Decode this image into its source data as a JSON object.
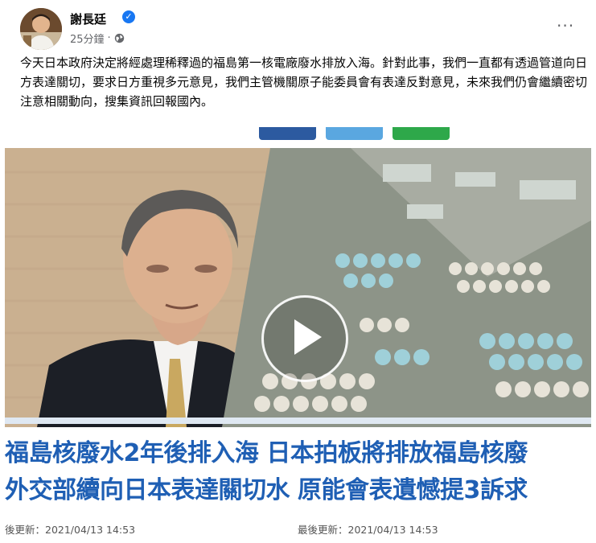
{
  "post": {
    "author": "謝長廷",
    "time": "25分鐘",
    "time_separator": "·",
    "more_label": "···",
    "text": "今天日本政府決定將經處理稀釋過的福島第一核電廠廢水排放入海。針對此事，我們一直都有透過管道向日方表達關切，要求日方重視多元意見，我們主管機關原子能委員會有表達反對意見，未來我們仍會繼續密切注意相關動向，搜集資訊回報國內。"
  },
  "media": {
    "headline_line1": "福島核廢水2年後排入海 日本拍板將排放福島核廢",
    "headline_line2": "外交部續向日本表達關切水 原能會表遺憾提3訴求",
    "timestamp_left": "後更新：2021/04/13 14:53",
    "timestamp_right": "最後更新：2021/04/13 14:53"
  },
  "colors": {
    "verified": "#1877f2",
    "headline": "#1f5fb4",
    "secondary_text": "#65676b",
    "strip_left": "#2c5aa0",
    "strip_mid": "#5aa7e0",
    "strip_right": "#2ea84a"
  },
  "icons": [
    "verified-badge-icon",
    "globe-icon",
    "more-options-icon",
    "play-icon"
  ]
}
